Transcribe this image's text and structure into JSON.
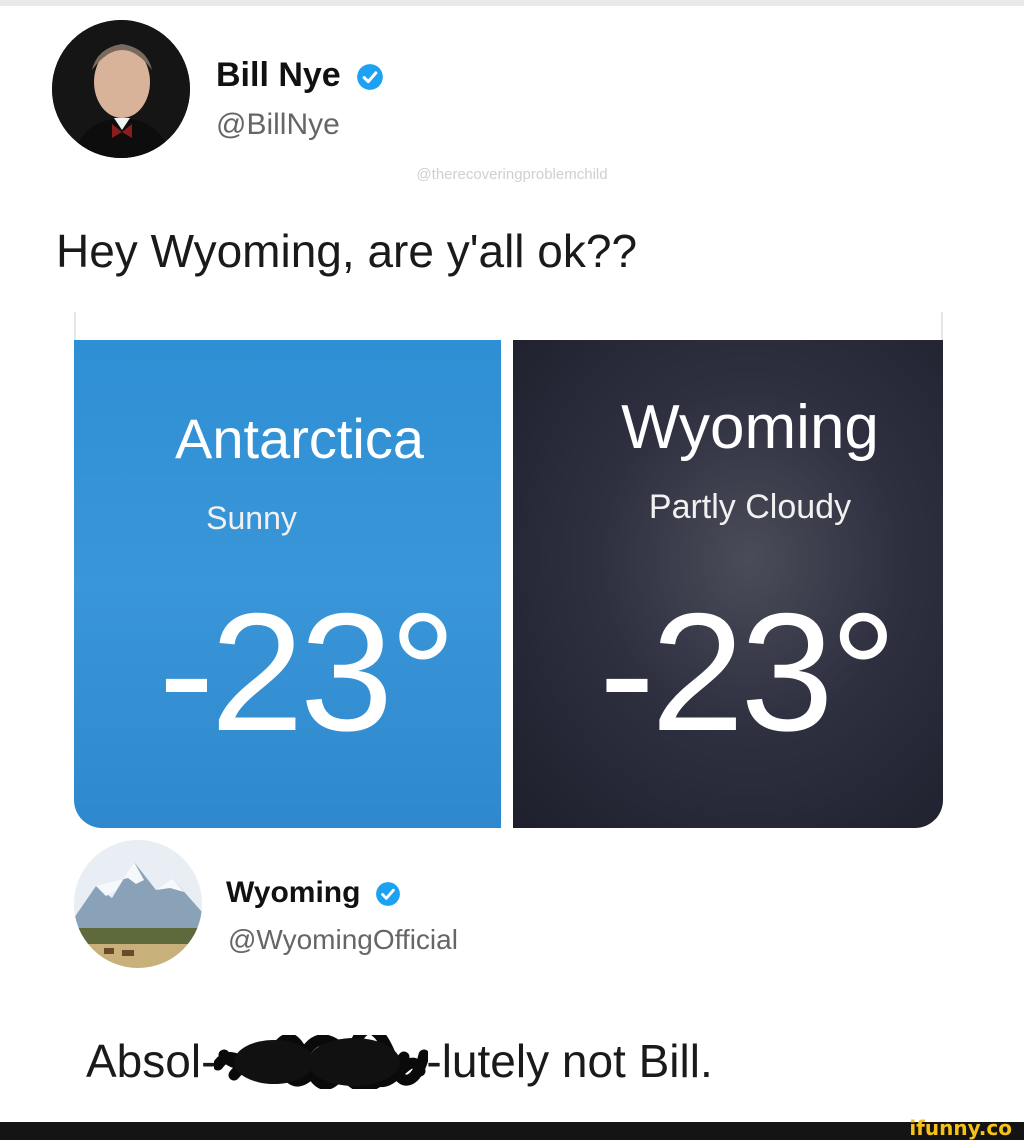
{
  "tweet": {
    "author": {
      "name": "Bill Nye",
      "handle": "@BillNye",
      "verified_icon": "verified-badge-icon"
    },
    "credit": "@therecoveringproblemchild",
    "text": "Hey Wyoming, are y'all ok??"
  },
  "weather": [
    {
      "city": "Antarctica",
      "condition": "Sunny",
      "temperature": "-23°",
      "color": "#3996d8"
    },
    {
      "city": "Wyoming",
      "condition": "Partly Cloudy",
      "temperature": "-23°",
      "color": "#23253a"
    }
  ],
  "reply": {
    "author": {
      "name": "Wyoming",
      "handle": "@WyomingOfficial",
      "verified_icon": "verified-badge-icon"
    },
    "text_before": "Absol-",
    "text_after": "-lutely not Bill."
  },
  "watermark": "ifunny.co",
  "colors": {
    "verified": "#1da1f2",
    "watermark": "#f6c21a"
  }
}
